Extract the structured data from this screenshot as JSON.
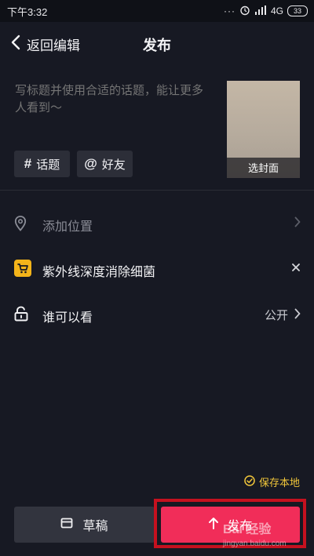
{
  "status_bar": {
    "time": "下午3:32",
    "dots": "···",
    "network": "4G",
    "battery": "33"
  },
  "header": {
    "back_label": "返回编辑",
    "title": "发布"
  },
  "composer": {
    "placeholder": "写标题并使用合适的话题，能让更多人看到～",
    "cover_label": "选封面",
    "topic_label": "话题",
    "friend_label": "好友"
  },
  "rows": {
    "location_label": "添加位置",
    "product_label": "紫外线深度消除细菌",
    "privacy_label": "谁可以看",
    "privacy_value": "公开"
  },
  "footer": {
    "save_local_label": "保存本地",
    "draft_label": "草稿",
    "publish_label": "发布"
  },
  "colors": {
    "background": "#171923",
    "accent": "#f12d59",
    "save_local": "#f1c63a",
    "highlight_frame": "#c5111f"
  },
  "icons": [
    "back-chevron-icon",
    "hash-icon",
    "at-icon",
    "location-pin-icon",
    "cart-icon",
    "unlock-icon",
    "chevron-right-icon",
    "close-icon",
    "check-circle-icon",
    "draft-box-icon",
    "upload-arrow-icon"
  ],
  "watermark": {
    "text": "Bai 经验",
    "domain": "jingyan.baidu.com"
  }
}
